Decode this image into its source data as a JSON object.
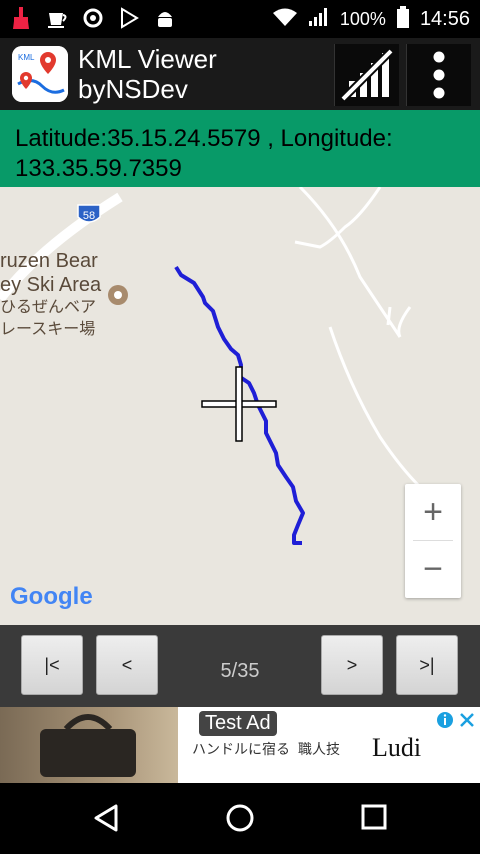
{
  "status": {
    "battery_text": "100%",
    "time": "14:56",
    "left_icons": [
      "broom-icon",
      "coffee-icon",
      "sync-icon",
      "play-store-icon",
      "android-icon"
    ]
  },
  "app": {
    "title_line1": "KML Viewer",
    "title_line2": "byNSDev",
    "icon_text": "KML"
  },
  "coords": {
    "line1": "Latitude:35.15.24.5579 , Longitude:",
    "line2": "133.35.59.7359"
  },
  "map": {
    "road_number": "58",
    "place_label_en1": "ruzen Bear",
    "place_label_en2": "ey Ski Area",
    "place_label_jp1": "ひるぜんベア",
    "place_label_jp2": "レースキー場",
    "google_logo": "Google",
    "zoom_in": "+",
    "zoom_out": "−",
    "track_color": "#1f1fd6"
  },
  "nav": {
    "first": "|<",
    "prev": "<",
    "position": "5/35",
    "next": ">",
    "last": ">|"
  },
  "ad": {
    "badge": "Test Ad",
    "tagline": "ハンドルに宿る",
    "tagline2": "職人技",
    "brand": "Ludi"
  }
}
